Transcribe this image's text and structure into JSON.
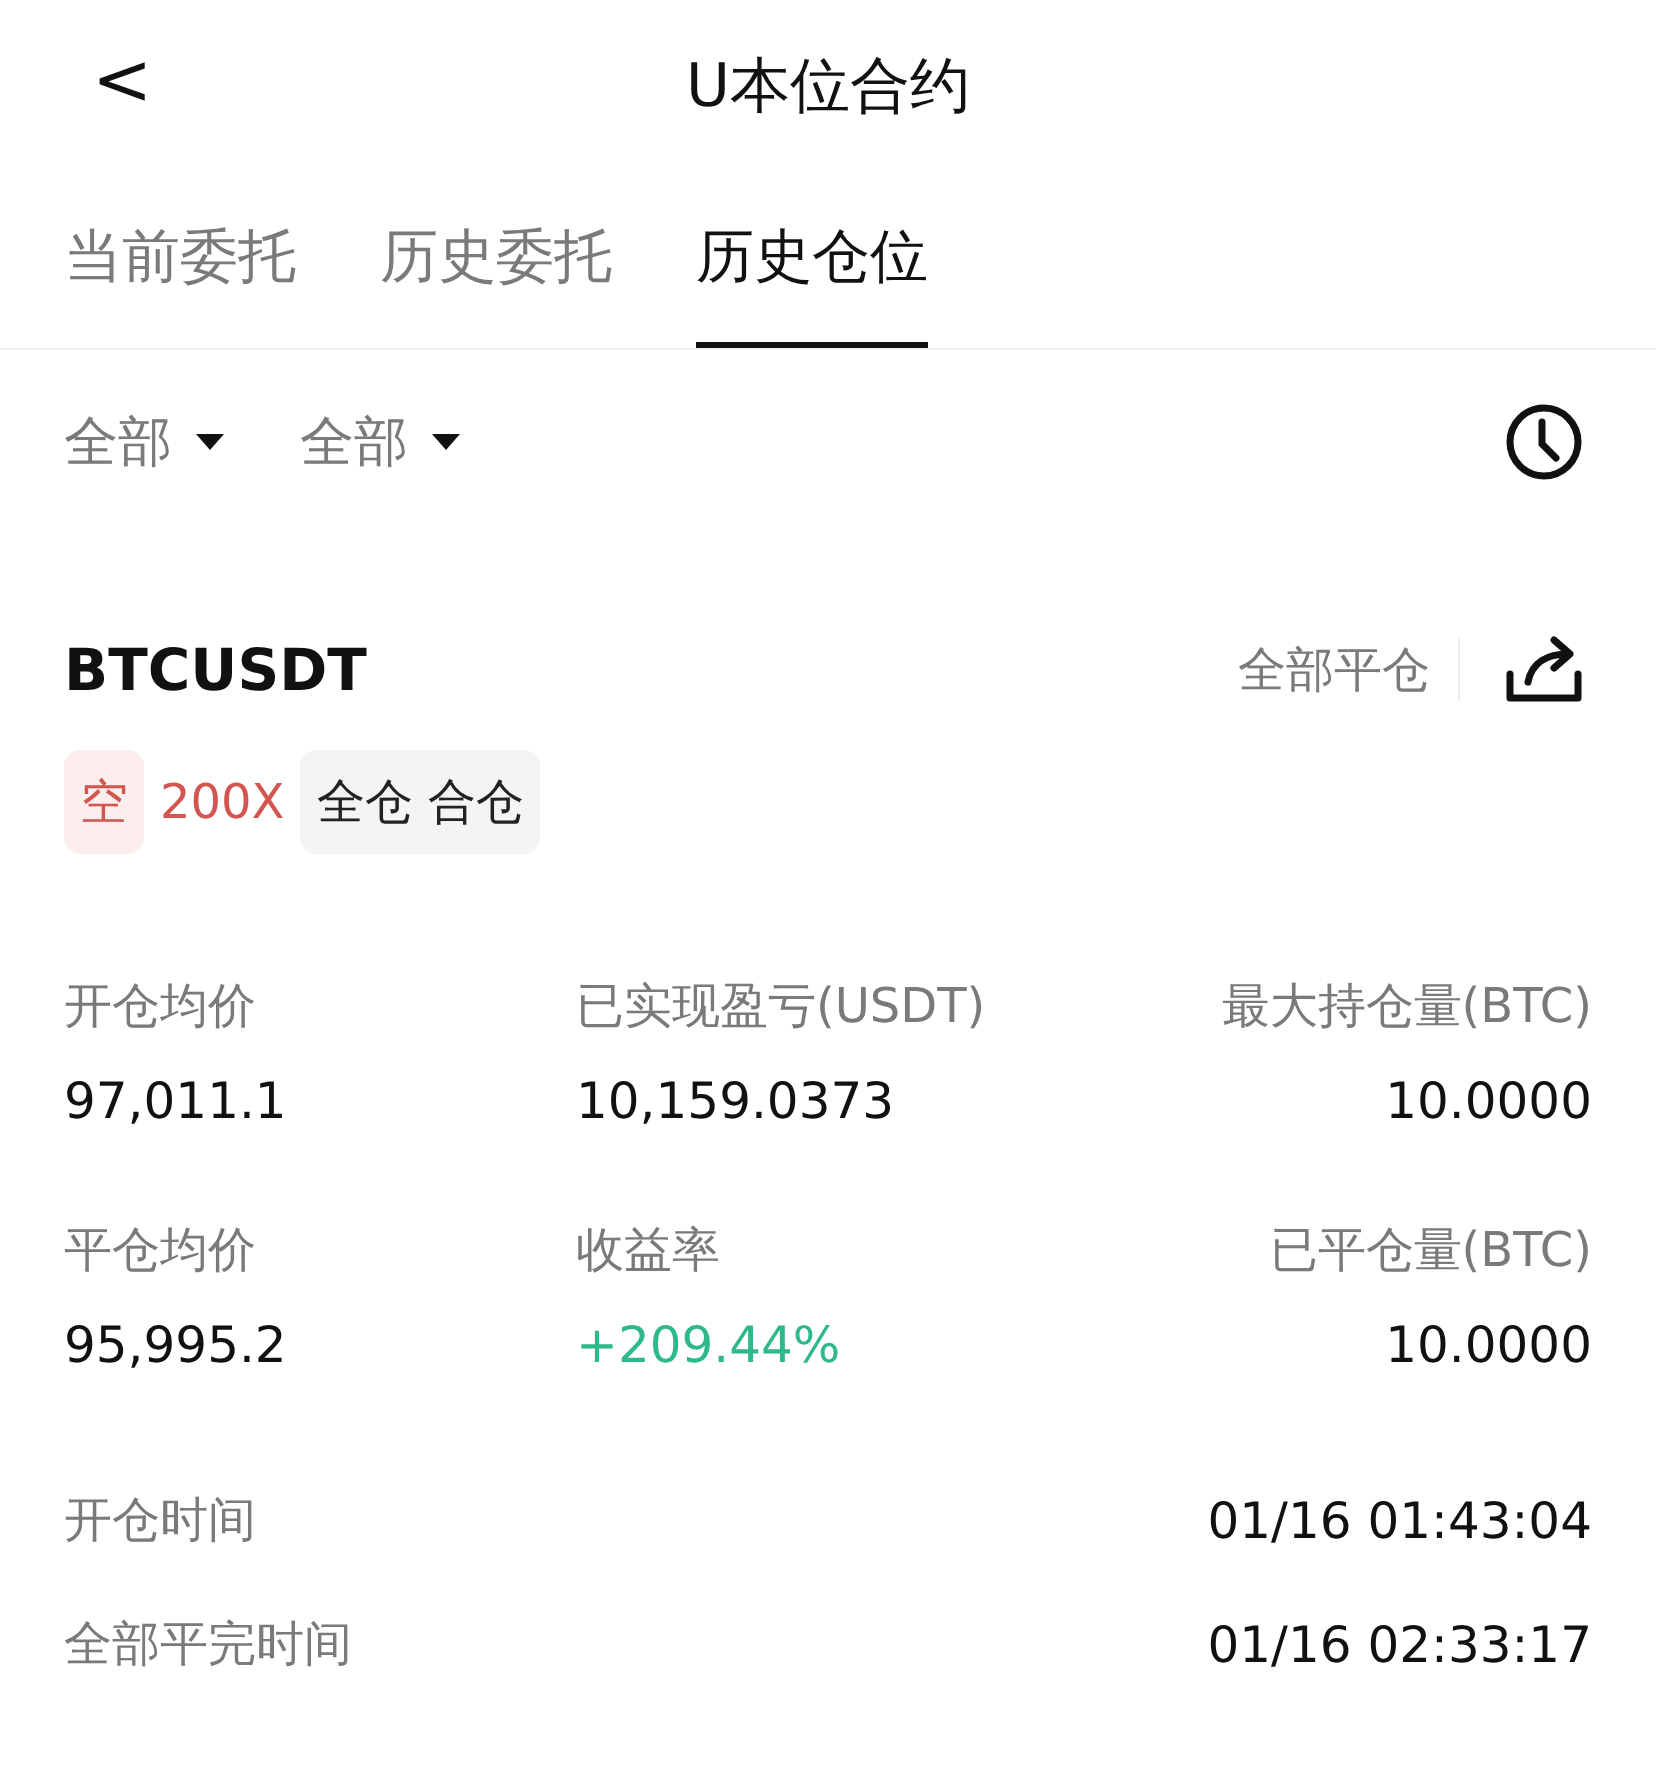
{
  "header": {
    "back": "<",
    "title": "U本位合约"
  },
  "tabs": [
    {
      "label": "当前委托",
      "selected": false
    },
    {
      "label": "历史委托",
      "selected": false
    },
    {
      "label": "历史仓位",
      "selected": true
    }
  ],
  "filters": [
    "全部",
    "全部"
  ],
  "position": {
    "symbol": "BTCUSDT",
    "close_all": "全部平仓",
    "tags": [
      {
        "text": "空",
        "kind": "side"
      },
      {
        "text": "200X",
        "kind": "leverage"
      },
      {
        "text": "全仓 合仓",
        "kind": "mode"
      }
    ],
    "stats": [
      {
        "label": "开仓均价",
        "value": "97,011.1",
        "kind": "plain"
      },
      {
        "label": "已实现盈亏(USDT)",
        "value": "10,159.0373",
        "kind": "plain"
      },
      {
        "label": "最大持仓量(BTC)",
        "value": "10.0000",
        "kind": "plain"
      },
      {
        "label": "平仓均价",
        "value": "95,995.2",
        "kind": "plain"
      },
      {
        "label": "收益率",
        "value": "+209.44%",
        "kind": "gain"
      },
      {
        "label": "已平仓量(BTC)",
        "value": "10.0000",
        "kind": "plain"
      }
    ],
    "times": [
      {
        "label": "开仓时间",
        "value": "01/16 01:43:04"
      },
      {
        "label": "全部平完时间",
        "value": "01/16 02:33:17"
      }
    ]
  }
}
